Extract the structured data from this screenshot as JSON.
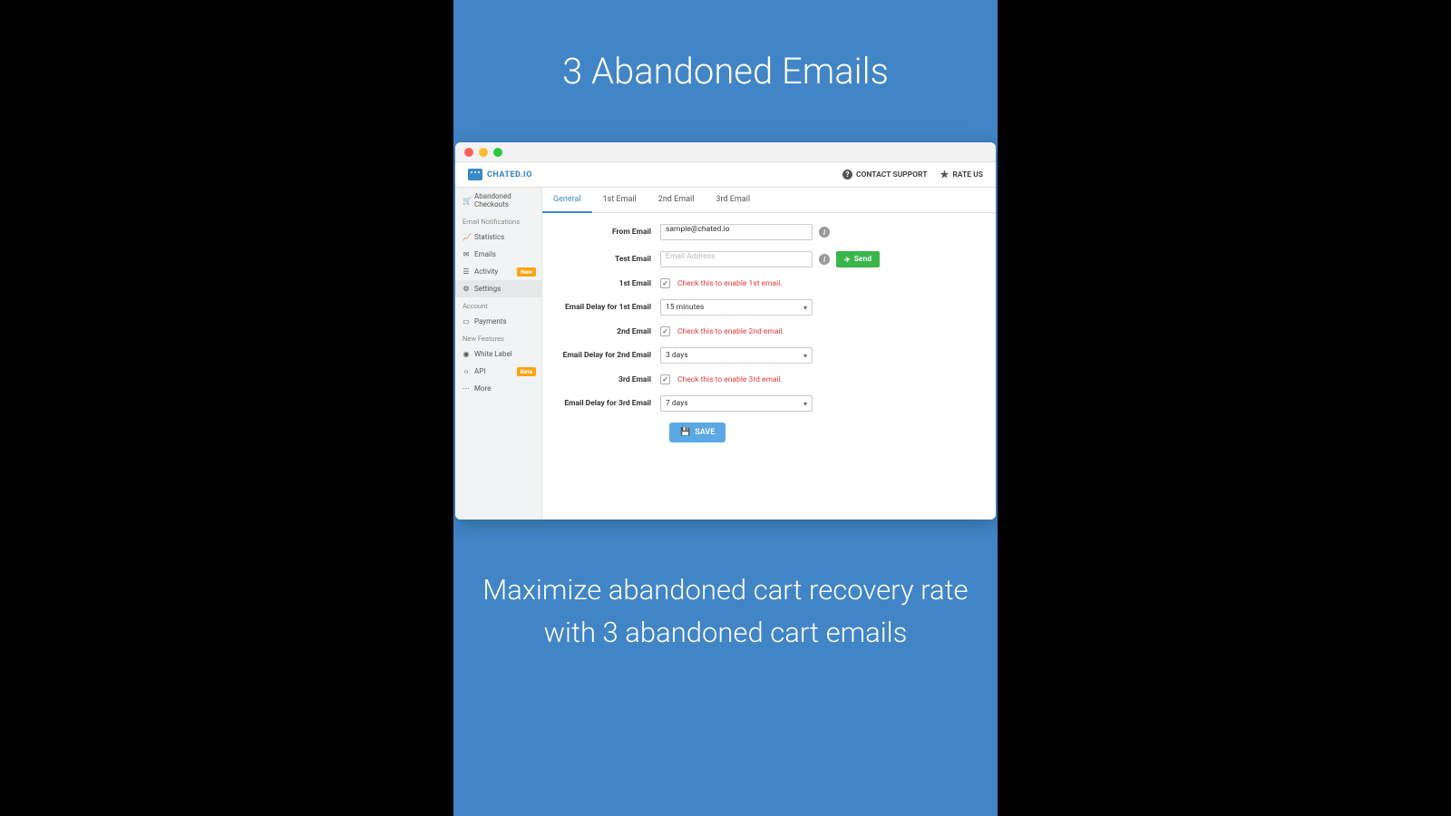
{
  "promo": {
    "title": "3 Abandoned Emails",
    "subtitle": "Maximize abandoned cart recovery rate with 3 abandoned cart emails"
  },
  "header": {
    "brand": "CHATED.IO",
    "contact_support": "CONTACT SUPPORT",
    "rate_us": "RATE US"
  },
  "sidebar": {
    "abandoned_checkouts": "Abandoned Checkouts",
    "section_email": "Email Notifications",
    "statistics": "Statistics",
    "emails": "Emails",
    "activity": "Activity",
    "activity_badge": "New",
    "settings": "Settings",
    "section_account": "Account",
    "payments": "Payments",
    "section_new": "New Features",
    "white_label": "White Label",
    "api": "API",
    "api_badge": "Beta",
    "more": "More"
  },
  "tabs": {
    "general": "General",
    "email1": "1st Email",
    "email2": "2nd Email",
    "email3": "3rd Email"
  },
  "form": {
    "from_email_label": "From Email",
    "from_email_value": "sample@chated.io",
    "test_email_label": "Test Email",
    "test_email_placeholder": "Email Address",
    "send_label": "Send",
    "email1_label": "1st Email",
    "email1_helper": "Check this to enable 1st email.",
    "delay1_label": "Email Delay for 1st Email",
    "delay1_value": "15 minutes",
    "email2_label": "2nd Email",
    "email2_helper": "Check this to enable 2nd email.",
    "delay2_label": "Email Delay for 2nd Email",
    "delay2_value": "3 days",
    "email3_label": "3rd Email",
    "email3_helper": "Check this to enable 3rd email.",
    "delay3_label": "Email Delay for 3rd Email",
    "delay3_value": "7 days",
    "save_label": "SAVE"
  }
}
